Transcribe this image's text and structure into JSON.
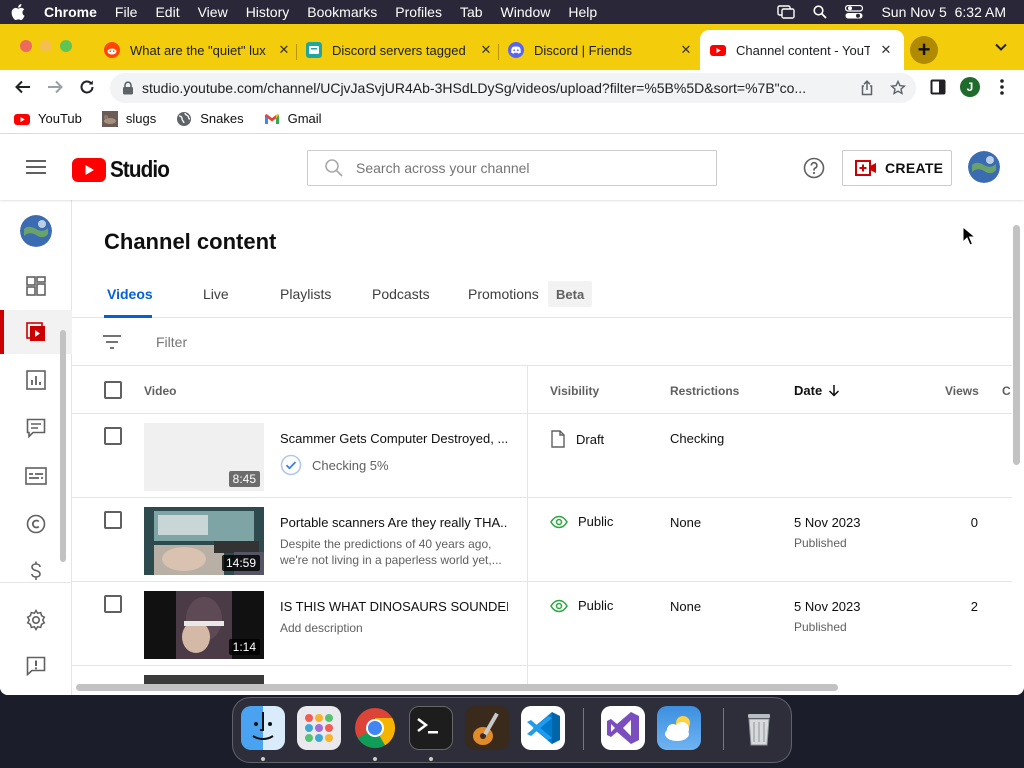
{
  "menubar": {
    "app": "Chrome",
    "items": [
      "File",
      "Edit",
      "View",
      "History",
      "Bookmarks",
      "Profiles",
      "Tab",
      "Window",
      "Help"
    ],
    "datetime": "Sun Nov 5  6:32 AM"
  },
  "browser": {
    "tabs": [
      {
        "title": "What are the \"quiet\" lux",
        "icon": "reddit-icon"
      },
      {
        "title": "Discord servers tagged",
        "icon": "disboard-icon"
      },
      {
        "title": "Discord | Friends",
        "icon": "discord-icon"
      },
      {
        "title": "Channel content - YouTu",
        "icon": "youtube-icon",
        "active": true
      }
    ],
    "url": "studio.youtube.com/channel/UCjvJaSvjUR4Ab-3HSdLDySg/videos/upload?filter=%5B%5D&sort=%7B\"co...",
    "profile_initial": "J",
    "bookmarks": [
      {
        "label": "YouTub",
        "icon": "youtube-icon"
      },
      {
        "label": "slugs",
        "icon": "slug-image-icon"
      },
      {
        "label": "Snakes",
        "icon": "globe-icon"
      },
      {
        "label": "Gmail",
        "icon": "gmail-icon"
      }
    ]
  },
  "studio": {
    "logo_text": "Studio",
    "search_placeholder": "Search across your channel",
    "create_label": "CREATE",
    "page_title": "Channel content",
    "tabs": [
      {
        "label": "Videos",
        "active": true
      },
      {
        "label": "Live"
      },
      {
        "label": "Playlists"
      },
      {
        "label": "Podcasts"
      },
      {
        "label": "Promotions"
      }
    ],
    "beta_label": "Beta",
    "filter_placeholder": "Filter",
    "columns": {
      "video": "Video",
      "visibility": "Visibility",
      "restrictions": "Restrictions",
      "date": "Date",
      "views": "Views",
      "comments": "C"
    },
    "rows": [
      {
        "title": "Scammer Gets Computer Destroyed, ...",
        "progress": "Checking 5%",
        "duration": "8:45",
        "visibility": "Draft",
        "restrictions": "Checking",
        "date": "",
        "date_status": "",
        "views": ""
      },
      {
        "title": "Portable scanners Are they really THA...",
        "description": "Despite the predictions of 40 years ago, we're not living in a paperless world yet,...",
        "duration": "14:59",
        "visibility": "Public",
        "restrictions": "None",
        "date": "5 Nov 2023",
        "date_status": "Published",
        "views": "0"
      },
      {
        "title": "IS THIS WHAT DINOSAURS SOUNDED ...",
        "description": "Add description",
        "duration": "1:14",
        "visibility": "Public",
        "restrictions": "None",
        "date": "5 Nov 2023",
        "date_status": "Published",
        "views": "2"
      }
    ]
  },
  "colors": {
    "tabstrip": "#f3cc0b",
    "youtube_red": "#ff0000",
    "link_blue": "#065fd4",
    "public_green": "#2ba640"
  }
}
